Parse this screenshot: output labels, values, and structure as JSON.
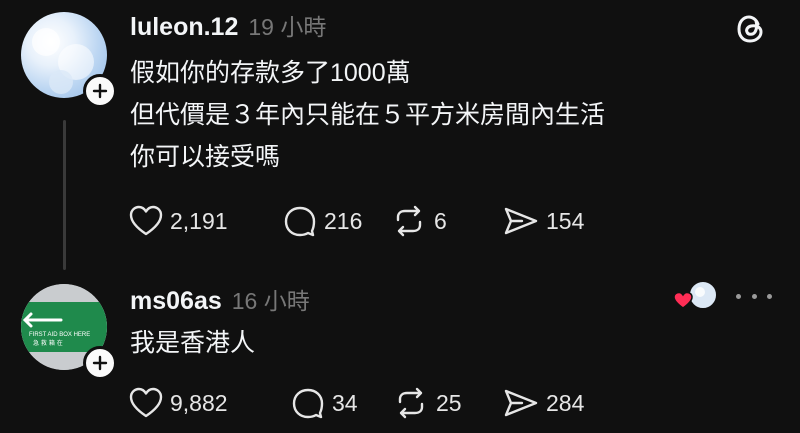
{
  "brand": {
    "icon": "threads-logo-icon"
  },
  "posts": [
    {
      "username": "luleon.12",
      "time": "19 小時",
      "lines": [
        "假如你的存款多了1000萬",
        "但代價是３年內只能在５平方米房間內生活",
        "你可以接受嗎"
      ],
      "likes": "2,191",
      "replies": "216",
      "reposts": "6",
      "shares": "154"
    },
    {
      "username": "ms06as",
      "time": "16 小時",
      "lines": [
        "我是香港人"
      ],
      "likes": "9,882",
      "replies": "34",
      "reposts": "25",
      "shares": "284",
      "avatar_sign_text": "FIRST AID BOX HERE / 急 救 箱 在"
    }
  ],
  "colors": {
    "background": "#101010",
    "text": "#f3f5f7",
    "muted": "#777777",
    "heart": "#ff2d55"
  }
}
